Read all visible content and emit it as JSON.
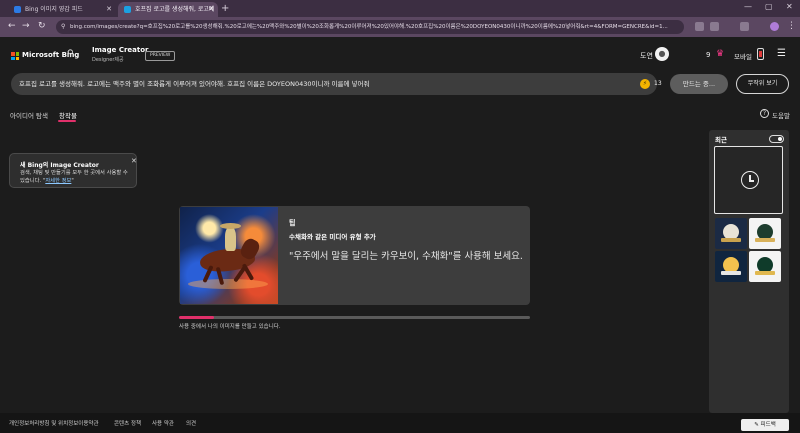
{
  "browser": {
    "tabs": [
      {
        "title": "Bing 이미지 영감 피드",
        "favicon_color": "#2c7be5"
      },
      {
        "title": "호프집 로고를 생성해줘, 로고에",
        "favicon_color": "#1ba1e2"
      }
    ],
    "new_tab": "+",
    "url": "bing.com/images/create?q=호프집%20로고를%20생성해줘.%20로고에는%20맥주와%20별이%20조화롭게%20이루어져%20있어야해.%20호프집%20이름은%20DOYEON0430이니까%20이름에%20넣어줘&rt=4&FORM=GENCRE&id=1..."
  },
  "header": {
    "brand": "Microsoft Bing",
    "product_title": "Image Creator",
    "product_subtitle": "Designer제공",
    "badge": "PREVIEW",
    "user_name": "도연",
    "points": "9",
    "mobile_label": "모바일"
  },
  "prompt": {
    "text": "호프집 로고를 생성해줘. 로고에는 맥주와 별이 조화롭게 이루어져 있어야해. 호프집 이름은 DOYEON0430이니까 이름에 넣어줘",
    "boosts": "13",
    "create_label": "만드는 중...",
    "surprise_label": "무작위 보기"
  },
  "tabs": {
    "ideas": "아이디어 탐색",
    "creations": "창작물",
    "help": "도움말"
  },
  "popover": {
    "title": "새 Bing의 Image Creator",
    "body": "검색, 채팅 및 만들기를 모두 한 곳에서 사용할 수 있습니다.",
    "link": "자세한 정보"
  },
  "tip": {
    "label": "팁",
    "heading": "수채화와 같은 미디어 유형 추가",
    "text": "\"우주에서 말을 달리는 카우보이, 수채화\"를 사용해 보세요."
  },
  "progress": {
    "fraction": 0.1,
    "text": "사용 중에서 나의 이미지를 만들고 있습니다."
  },
  "recent": {
    "title": "최근",
    "thumbnails": [
      {
        "bg": "#1b2a44",
        "emblem": "#e8e3d6",
        "band": "#c9a24e"
      },
      {
        "bg": "#f4f4f4",
        "emblem": "#1d3d2e",
        "band": "#d8b15a"
      },
      {
        "bg": "#10253f",
        "emblem": "#f2c14e",
        "band": "#e6e6e6"
      },
      {
        "bg": "#f4f4f4",
        "emblem": "#0f3b2a",
        "band": "#e0b84f"
      }
    ]
  },
  "footer": {
    "links": [
      "개인정보처리방침 및 위치정보이용약관",
      "콘텐츠 정책",
      "사용 약관",
      "의견"
    ],
    "feedback": "피드백"
  }
}
